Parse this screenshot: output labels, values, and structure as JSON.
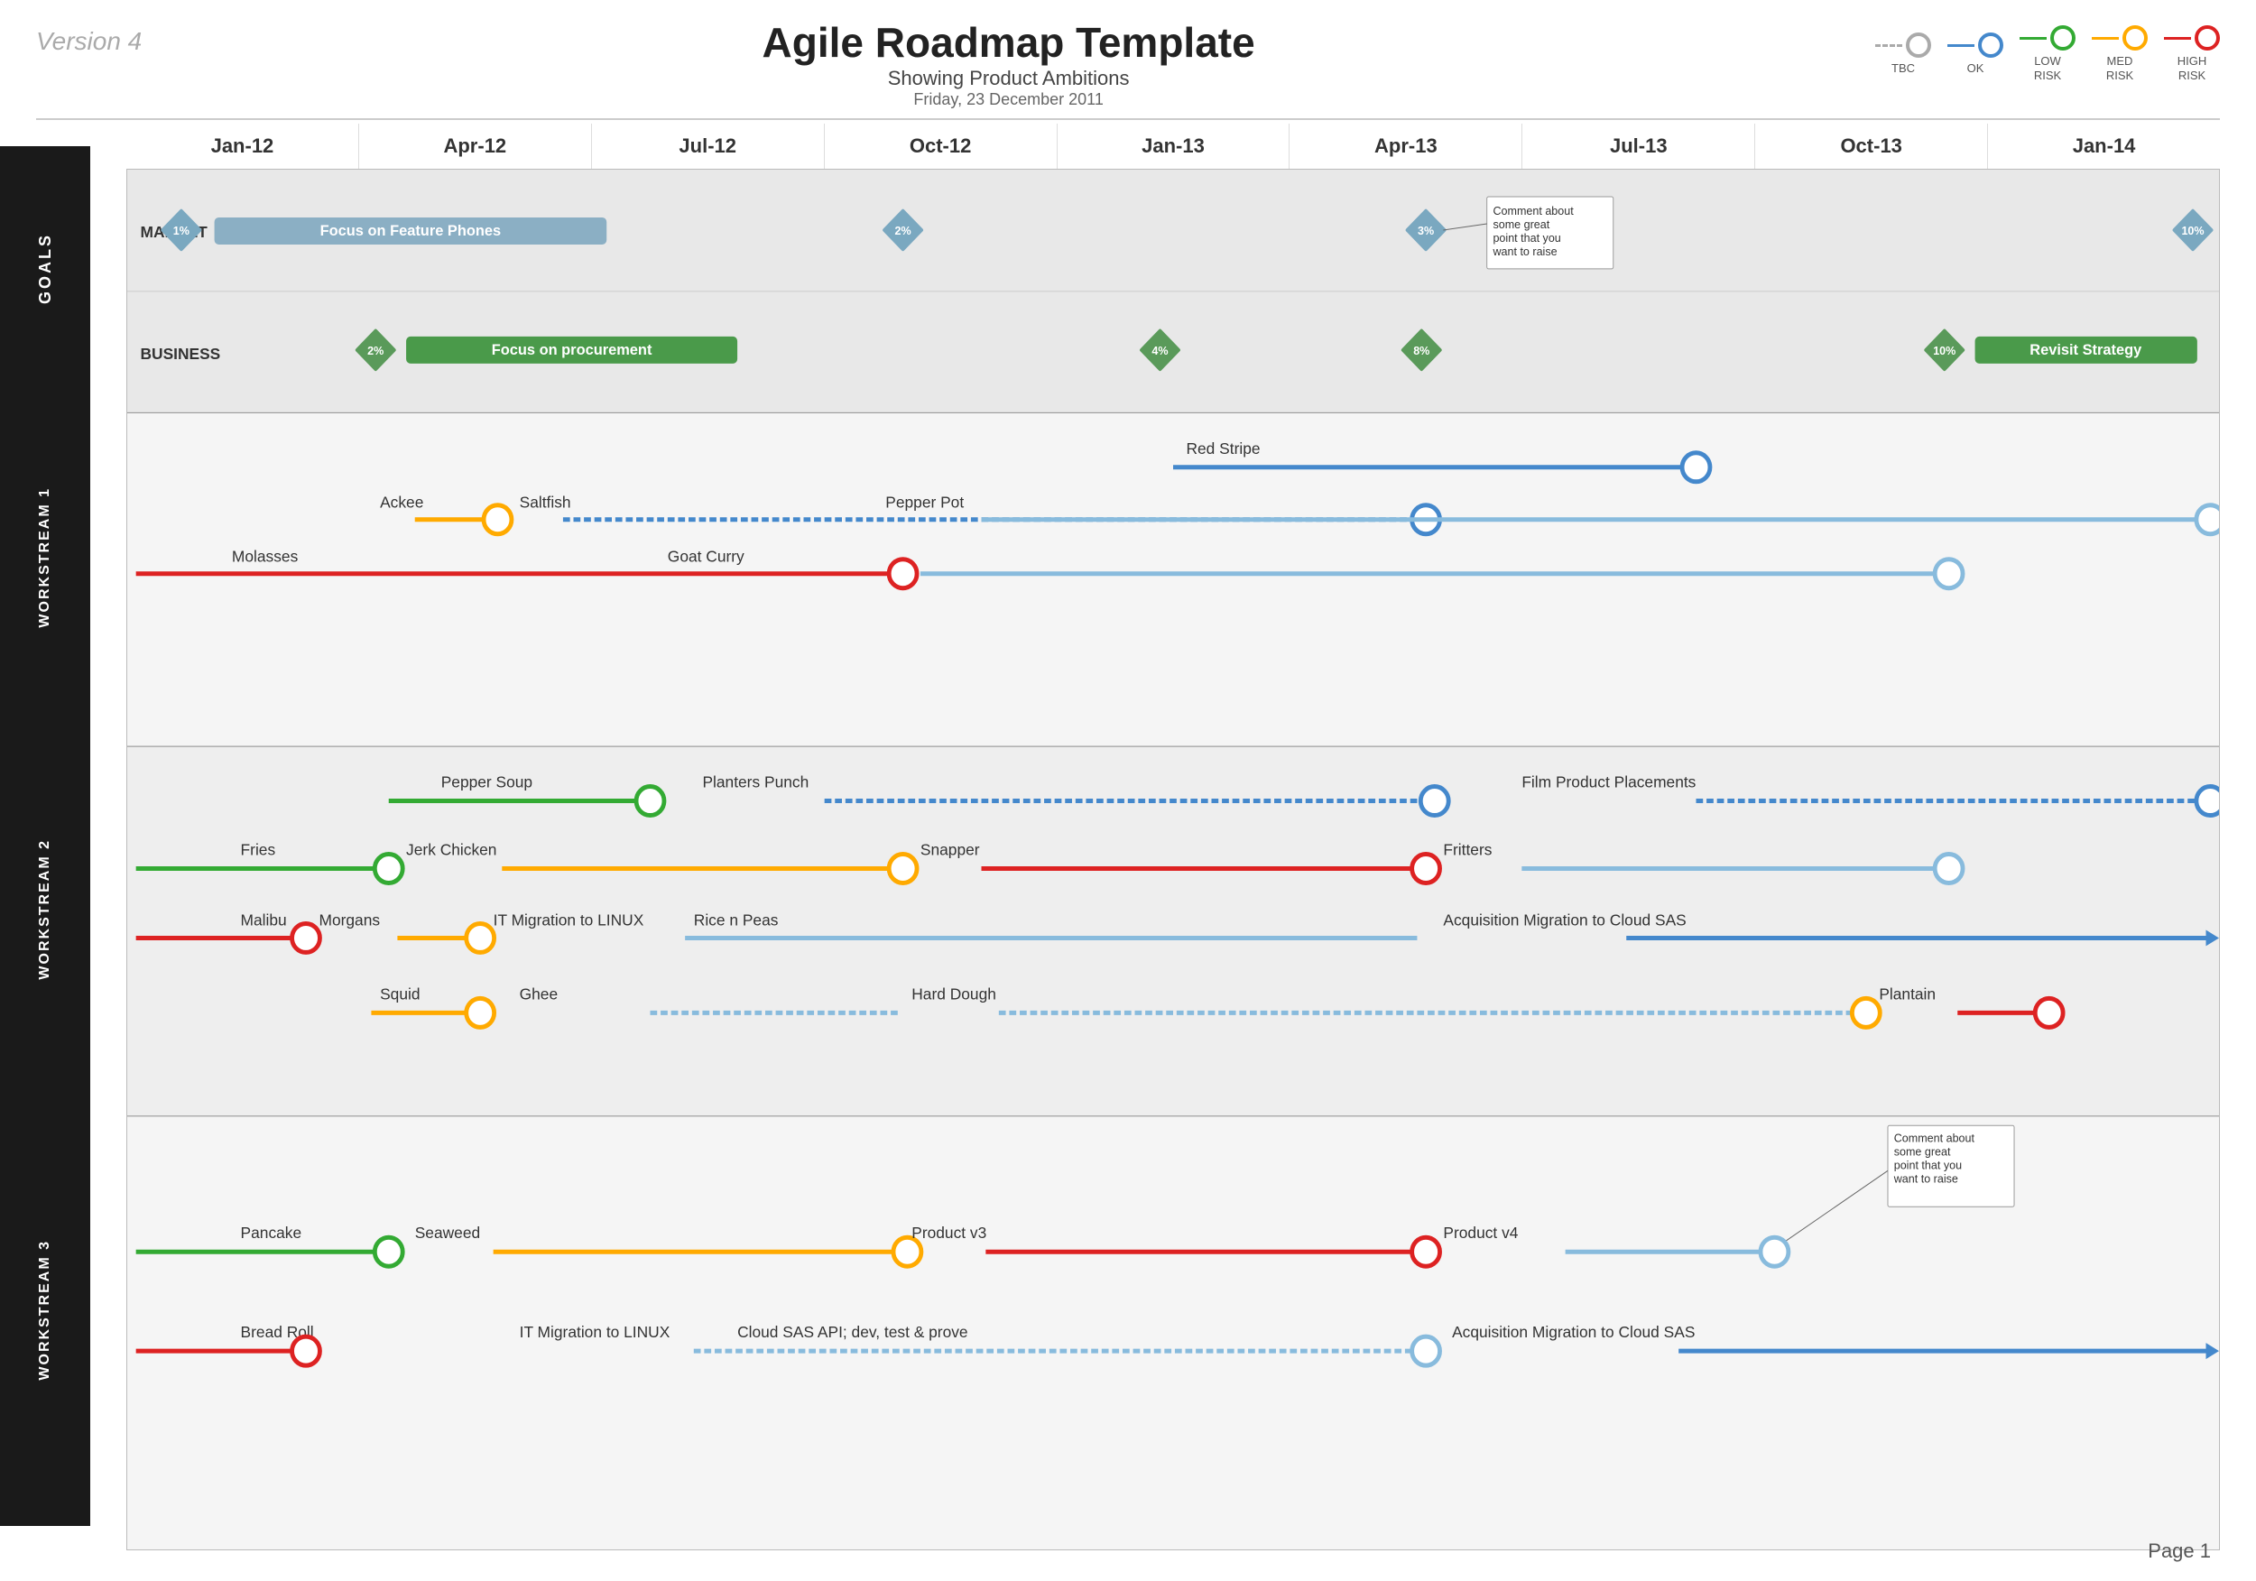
{
  "header": {
    "version": "Version 4",
    "title": "Agile Roadmap Template",
    "subtitle": "Showing Product Ambitions",
    "date": "Friday, 23 December 2011"
  },
  "legend": {
    "items": [
      {
        "label": "TBC",
        "color": "#aaaaaa"
      },
      {
        "label": "OK",
        "color": "#4488cc"
      },
      {
        "label": "LOW\nRISK",
        "color": "#33aa33"
      },
      {
        "label": "MED\nRISK",
        "color": "#ffaa00"
      },
      {
        "label": "HIGH\nRISK",
        "color": "#dd2222"
      }
    ]
  },
  "timeline": {
    "columns": [
      "Jan-12",
      "Apr-12",
      "Jul-12",
      "Oct-12",
      "Jan-13",
      "Apr-13",
      "Jul-13",
      "Oct-13",
      "Jan-14"
    ]
  },
  "goals": {
    "rows": [
      {
        "label": "MARKET"
      },
      {
        "label": "BUSINESS"
      }
    ]
  },
  "workstreams": [
    {
      "label": "WORKSTREAM 1"
    },
    {
      "label": "WORKSTREAM 2"
    },
    {
      "label": "WORKSTREAM 3"
    }
  ],
  "page": "Page 1"
}
